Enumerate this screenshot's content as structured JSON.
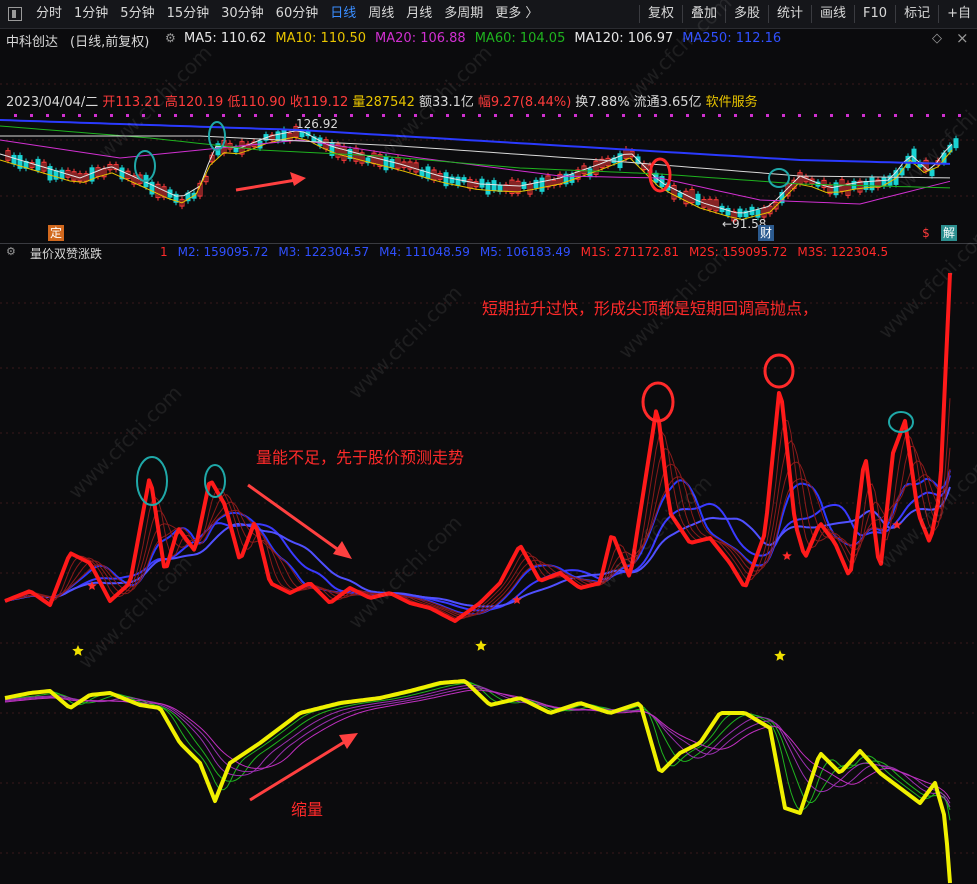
{
  "toolbar": {
    "items": [
      "分时",
      "1分钟",
      "5分钟",
      "15分钟",
      "30分钟",
      "60分钟",
      "日线",
      "周线",
      "月线",
      "多周期",
      "更多 〉"
    ],
    "active_index": 6,
    "right_items": [
      "复权",
      "叠加",
      "多股",
      "统计",
      "画线",
      "F10",
      "标记",
      "+自"
    ]
  },
  "main": {
    "stock_name": "中科创达",
    "period_info": "(日线,前复权)",
    "mas": [
      {
        "label": "MA5: 110.62",
        "color": "#e6e6e6"
      },
      {
        "label": "MA10: 110.50",
        "color": "#e8c400"
      },
      {
        "label": "MA20: 106.88",
        "color": "#d030d0"
      },
      {
        "label": "MA60: 104.05",
        "color": "#1fb31f"
      },
      {
        "label": "MA120: 106.97",
        "color": "#e6e6e6"
      },
      {
        "label": "MA250: 112.16",
        "color": "#3050ff"
      }
    ],
    "quote": [
      {
        "text": "2023/04/04/二",
        "color": "#d8d8d8"
      },
      {
        "text": "开113.21",
        "color": "#ff3b3b"
      },
      {
        "text": "高120.19",
        "color": "#ff3b3b"
      },
      {
        "text": "低110.90",
        "color": "#ff3b3b"
      },
      {
        "text": "收119.12",
        "color": "#ff3b3b"
      },
      {
        "text": "量287542",
        "color": "#e8c400"
      },
      {
        "text": "额33.1亿",
        "color": "#d8d8d8"
      },
      {
        "text": "幅9.27(8.44%)",
        "color": "#ff3b3b"
      },
      {
        "text": "换7.88%",
        "color": "#d8d8d8"
      },
      {
        "text": "流通3.65亿",
        "color": "#d8d8d8"
      },
      {
        "text": "软件服务",
        "color": "#e8c400"
      }
    ],
    "high_label": "126.92",
    "low_label": "←91.58",
    "marker_ding": "定",
    "marker_cai": "财",
    "marker_s": "$",
    "marker_jie": "解"
  },
  "indicator": {
    "name": "量价双赞涨跌",
    "values": [
      {
        "text": "1",
        "color": "#ff2a2a"
      },
      {
        "text": "M2: 159095.72",
        "color": "#3050ff"
      },
      {
        "text": "M3: 122304.57",
        "color": "#3050ff"
      },
      {
        "text": "M4: 111048.59",
        "color": "#3050ff"
      },
      {
        "text": "M5: 106183.49",
        "color": "#3050ff"
      },
      {
        "text": "M1S: 271172.81",
        "color": "#ff2a2a"
      },
      {
        "text": "M2S: 159095.72",
        "color": "#ff2a2a"
      },
      {
        "text": "M3S: 122304.5",
        "color": "#ff2a2a"
      }
    ]
  },
  "annotations": {
    "top_note": "短期拉升过快，形成尖顶都是短期回调高抛点，",
    "mid_note": "量能不足，先于股价预测走势",
    "bottom_note": "缩量"
  },
  "watermark": "www.cfchi.com"
}
